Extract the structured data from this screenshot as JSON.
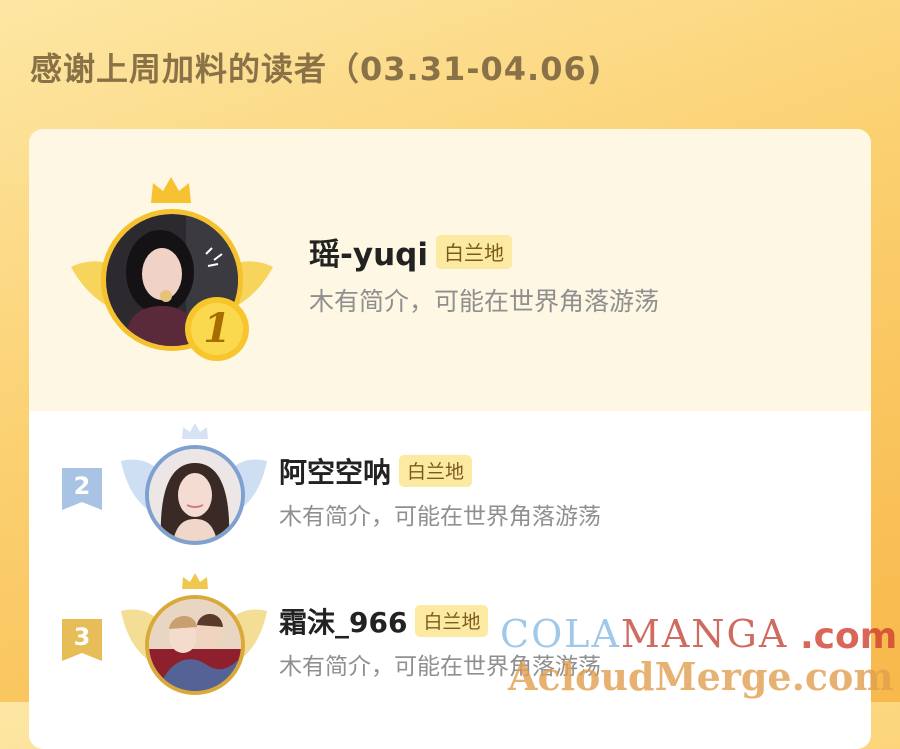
{
  "header": {
    "title": "感谢上周加料的读者（03.31-04.06)"
  },
  "ranking": [
    {
      "rank": "1",
      "name": "瑶-yuqi",
      "level": "白兰地",
      "bio": "木有简介，可能在世界角落游荡"
    },
    {
      "rank": "2",
      "name": "阿空空呐",
      "level": "白兰地",
      "bio": "木有简介，可能在世界角落游荡"
    },
    {
      "rank": "3",
      "name": "霜沫_966",
      "level": "白兰地",
      "bio": "木有简介，可能在世界角落游荡"
    }
  ],
  "watermark": {
    "brand_a": "COLA",
    "brand_b": "MANGA",
    "domain": ".com",
    "sub": "AcloudMerge.com"
  },
  "colors": {
    "background_top": "#fde7a4",
    "background_bottom": "#f8b84a",
    "gold": "#f5c12c",
    "silver": "#a9c3e4",
    "bronze": "#e6bd57",
    "level_badge_bg": "#fdeaa2"
  }
}
